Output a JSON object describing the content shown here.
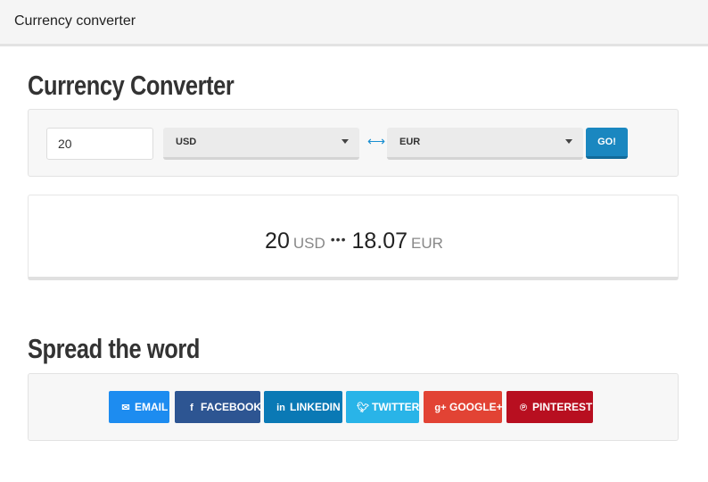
{
  "window": {
    "title": "Currency converter"
  },
  "converter": {
    "heading": "Currency Converter",
    "amount_value": "20",
    "from_currency": "USD",
    "to_currency": "EUR",
    "swap_icon": "swap-arrows-icon",
    "go_label": "GO!"
  },
  "result": {
    "amount": "20",
    "from_currency": "USD",
    "separator": "•••",
    "converted": "18.07",
    "to_currency": "EUR"
  },
  "share": {
    "heading": "Spread the word",
    "buttons": [
      {
        "label": "EMAIL",
        "icon": "envelope-icon",
        "color": "#1d8cf0"
      },
      {
        "label": "FACEBOOK",
        "icon": "facebook-icon",
        "color": "#2d5592"
      },
      {
        "label": "LINKEDIN",
        "icon": "linkedin-icon",
        "color": "#0a79b5"
      },
      {
        "label": "TWITTER",
        "icon": "twitter-icon",
        "color": "#29b4e8"
      },
      {
        "label": "GOOGLE+",
        "icon": "google-plus-icon",
        "color": "#e24334"
      },
      {
        "label": "PINTEREST",
        "icon": "pinterest-icon",
        "color": "#b80f20"
      }
    ]
  }
}
